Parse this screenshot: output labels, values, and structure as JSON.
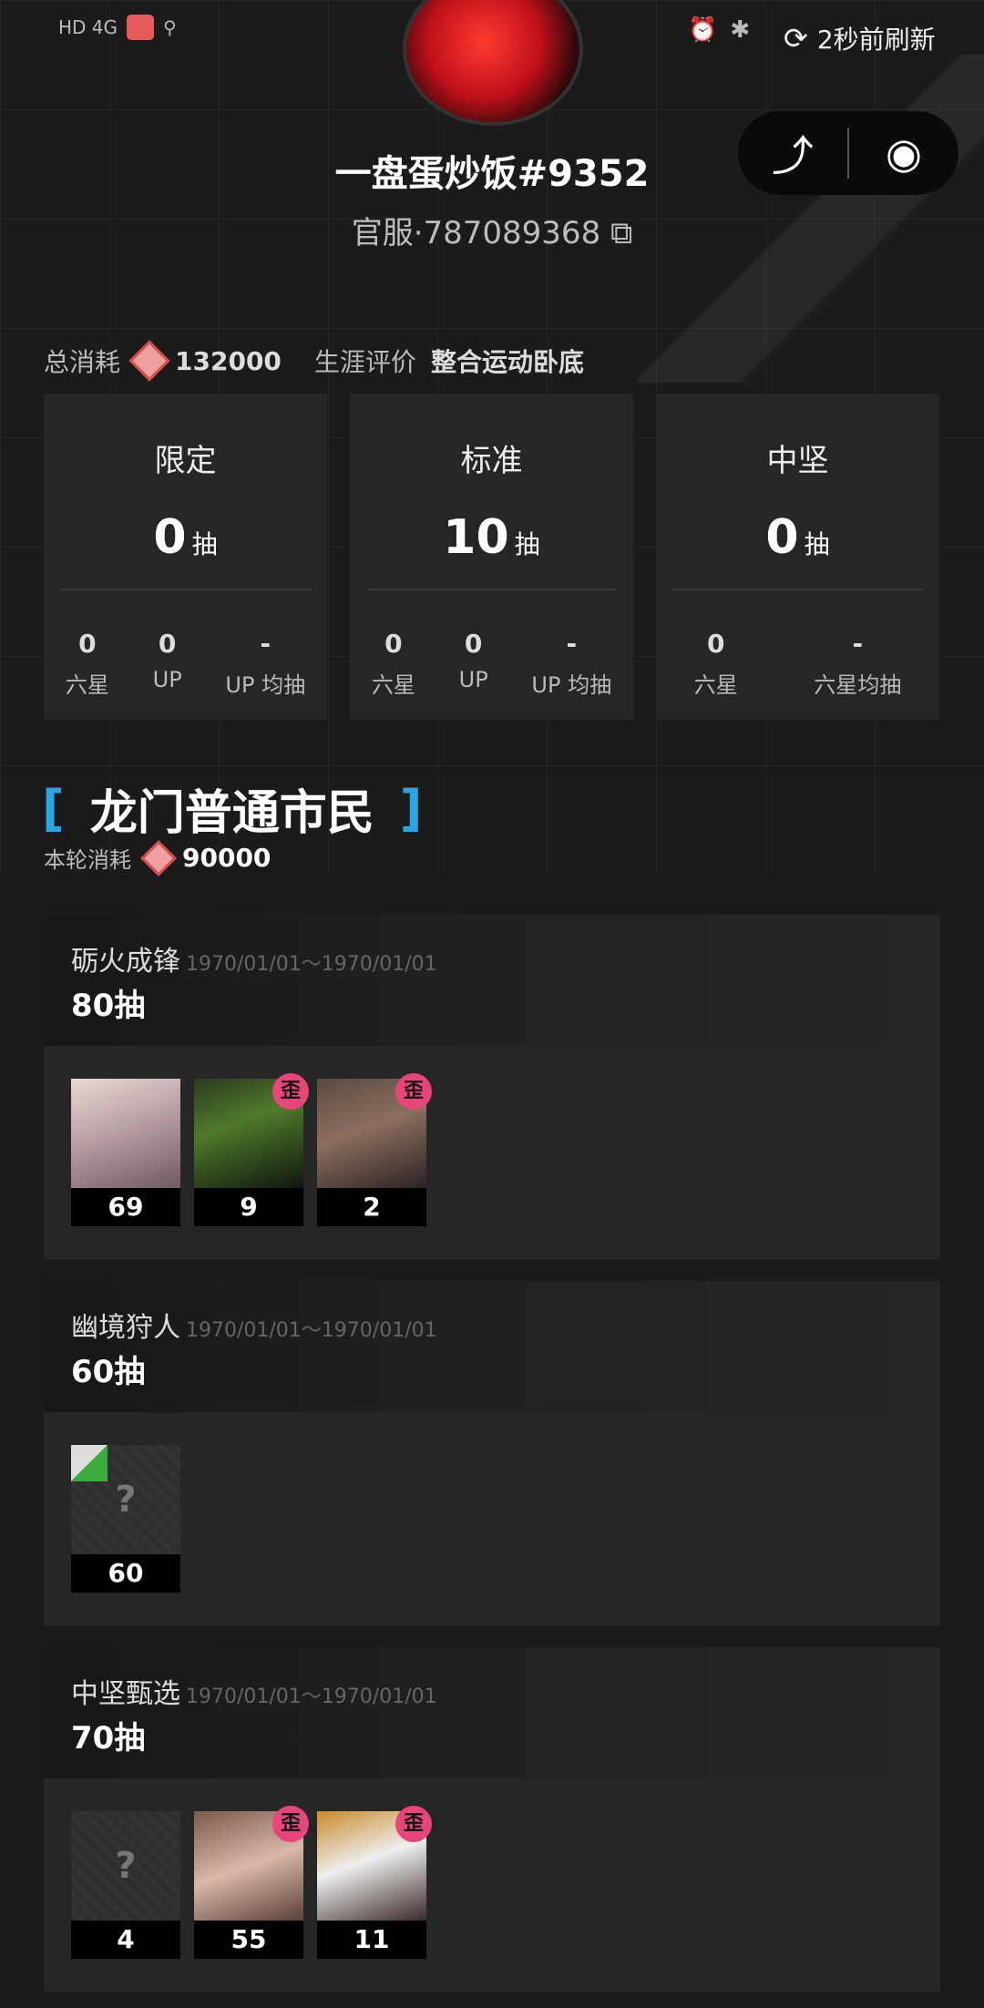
{
  "status_bar": {
    "left_text": "HD 4G",
    "refresh_text": "2秒前刷新"
  },
  "profile": {
    "name": "一盘蛋炒饭#9352",
    "server": "官服·787089368"
  },
  "summary": {
    "total_label": "总消耗",
    "total_value": "132000",
    "rating_label": "生涯评价",
    "rating_value": "整合运动卧底"
  },
  "cards": [
    {
      "title": "限定",
      "pulls": "0",
      "unit": "抽",
      "stats": [
        {
          "value": "0",
          "label": "六星"
        },
        {
          "value": "0",
          "label": "UP"
        },
        {
          "value": "-",
          "label": "UP 均抽"
        }
      ]
    },
    {
      "title": "标准",
      "pulls": "10",
      "unit": "抽",
      "stats": [
        {
          "value": "0",
          "label": "六星"
        },
        {
          "value": "0",
          "label": "UP"
        },
        {
          "value": "-",
          "label": "UP 均抽"
        }
      ]
    },
    {
      "title": "中坚",
      "pulls": "0",
      "unit": "抽",
      "stats": [
        {
          "value": "0",
          "label": "六星"
        },
        {
          "value": "-",
          "label": "六星均抽"
        }
      ]
    }
  ],
  "rank": {
    "title": "龙门普通市民",
    "bracket_left": "[",
    "bracket_right": "]",
    "round_cost_label": "本轮消耗",
    "round_cost_value": "90000"
  },
  "banners": [
    {
      "name": "砺火成锋",
      "dates": "1970/01/01～1970/01/01",
      "pulls": "80抽",
      "operators": [
        {
          "count": "69",
          "badge": ""
        },
        {
          "count": "9",
          "badge": "歪"
        },
        {
          "count": "2",
          "badge": "歪"
        }
      ]
    },
    {
      "name": "幽境狩人",
      "dates": "1970/01/01～1970/01/01",
      "pulls": "60抽",
      "operators": [
        {
          "count": "60",
          "badge": "",
          "unknown": "?"
        }
      ]
    },
    {
      "name": "中坚甄选",
      "dates": "1970/01/01～1970/01/01",
      "pulls": "70抽",
      "operators": [
        {
          "count": "4",
          "badge": "",
          "unknown": "?"
        },
        {
          "count": "55",
          "badge": "歪"
        },
        {
          "count": "11",
          "badge": "歪"
        }
      ]
    }
  ],
  "colors": {
    "accent_bracket": "#27a6e6",
    "badge": "#e8457a",
    "background": "#1b1b1b",
    "card": "#262626"
  },
  "icons": [
    "refresh-icon",
    "share-icon",
    "record-icon",
    "copy-icon",
    "orundum-gem-icon"
  ]
}
